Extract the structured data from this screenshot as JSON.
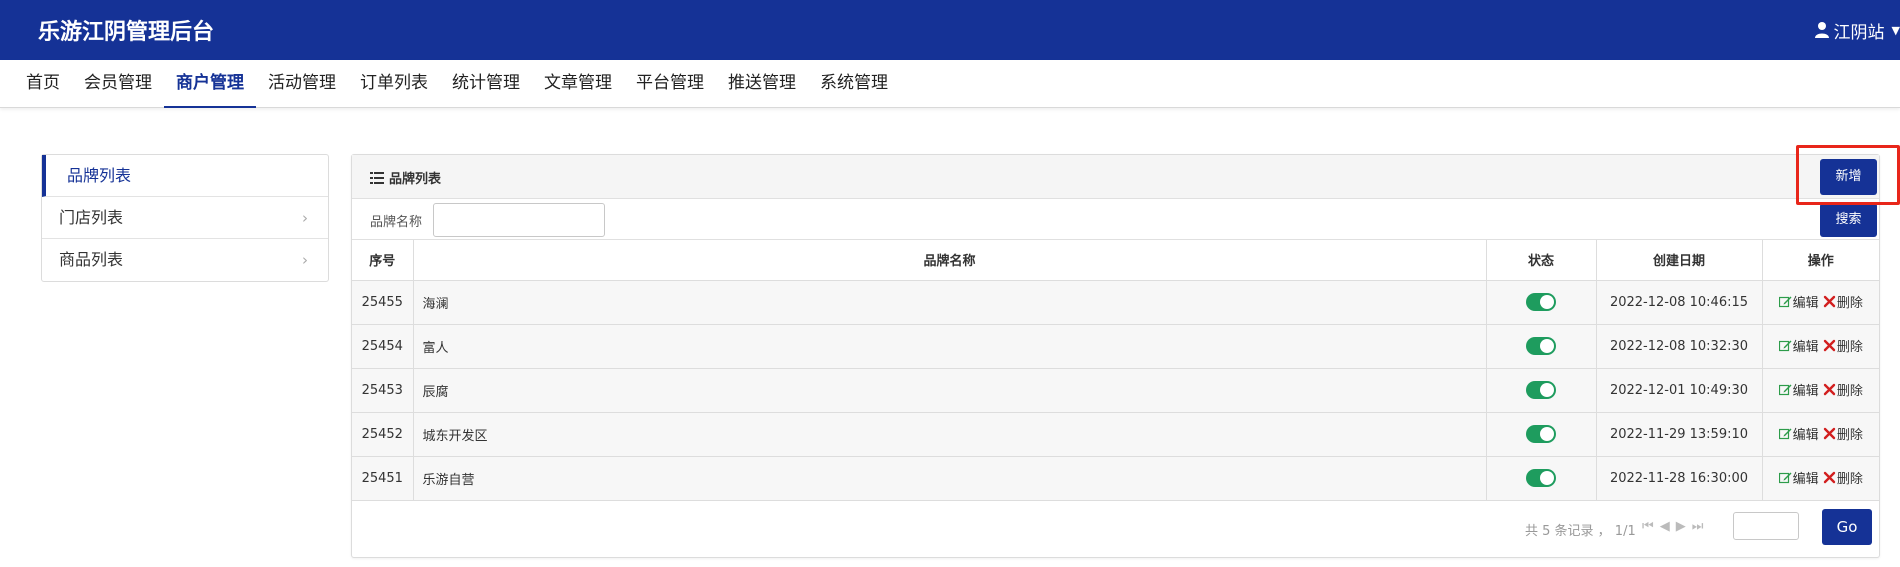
{
  "app": {
    "title": "乐游江阴管理后台"
  },
  "user": {
    "name": "江阴站"
  },
  "nav": {
    "items": [
      {
        "label": "首页"
      },
      {
        "label": "会员管理"
      },
      {
        "label": "商户管理",
        "active": true
      },
      {
        "label": "活动管理"
      },
      {
        "label": "订单列表"
      },
      {
        "label": "统计管理"
      },
      {
        "label": "文章管理"
      },
      {
        "label": "平台管理"
      },
      {
        "label": "推送管理"
      },
      {
        "label": "系统管理"
      }
    ]
  },
  "sidebar": {
    "items": [
      {
        "label": "品牌列表",
        "active": true
      },
      {
        "label": "门店列表"
      },
      {
        "label": "商品列表"
      }
    ]
  },
  "panel": {
    "title": "品牌列表",
    "add_label": "新增",
    "search_label": "品牌名称",
    "search_value": "",
    "search_button": "搜索"
  },
  "table": {
    "headers": [
      "序号",
      "品牌名称",
      "状态",
      "创建日期",
      "操作"
    ],
    "rows": [
      {
        "id": "25455",
        "name": "海澜",
        "status": true,
        "date": "2022-12-08 10:46:15"
      },
      {
        "id": "25454",
        "name": "富人",
        "status": true,
        "date": "2022-12-08 10:32:30"
      },
      {
        "id": "25453",
        "name": "辰腐",
        "status": true,
        "date": "2022-12-01 10:49:30"
      },
      {
        "id": "25452",
        "name": "城东开发区",
        "status": true,
        "date": "2022-11-29 13:59:10"
      },
      {
        "id": "25451",
        "name": "乐游自营",
        "status": true,
        "date": "2022-11-28 16:30:00"
      }
    ],
    "edit_label": "编辑",
    "delete_label": "删除"
  },
  "pager": {
    "summary": "共 5 条记录 ， 1/1",
    "go_label": "Go",
    "page_value": ""
  },
  "colors": {
    "primary": "#153296",
    "toggle_on": "#1e9c5e",
    "highlight": "#e8261a"
  }
}
